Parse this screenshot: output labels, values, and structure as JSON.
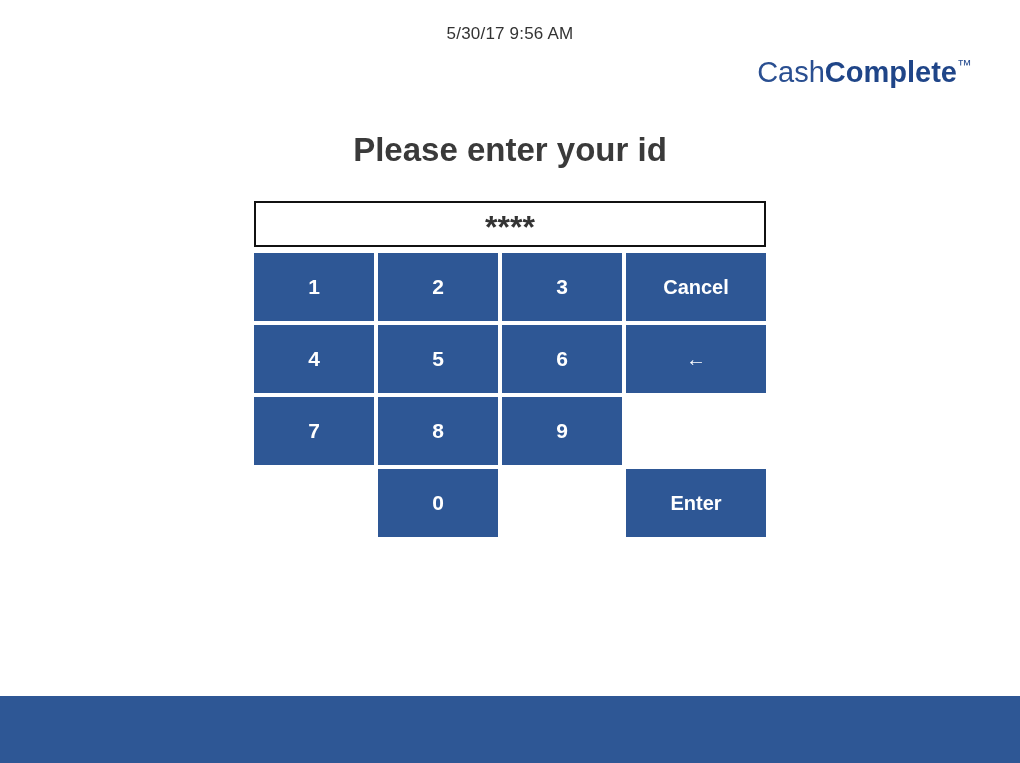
{
  "header": {
    "datetime": "5/30/17 9:56 AM",
    "logo": "Cash**Complete**$^{™}$"
  },
  "prompt": {
    "title": "Please enter your id"
  },
  "id_field": {
    "value": "****"
  },
  "keypad": {
    "rows": [
      [
        {
          "kind": "digit",
          "label": "1"
        },
        {
          "kind": "digit",
          "label": "2"
        },
        {
          "kind": "digit",
          "label": "3"
        },
        {
          "kind": "action",
          "label": "Cancel"
        }
      ],
      [
        {
          "kind": "digit",
          "label": "4"
        },
        {
          "kind": "digit",
          "label": "5"
        },
        {
          "kind": "digit",
          "label": "6"
        },
        {
          "kind": "action",
          "label": "←"
        }
      ],
      [
        {
          "kind": "digit",
          "label": "7"
        },
        {
          "kind": "digit",
          "label": "8"
        },
        {
          "kind": "digit",
          "label": "9"
        },
        {
          "kind": "spacer"
        }
      ],
      [
        {
          "kind": "spacer"
        },
        {
          "kind": "digit",
          "label": "0"
        },
        {
          "kind": "spacer"
        },
        {
          "kind": "action",
          "label": "Enter"
        }
      ]
    ]
  }
}
